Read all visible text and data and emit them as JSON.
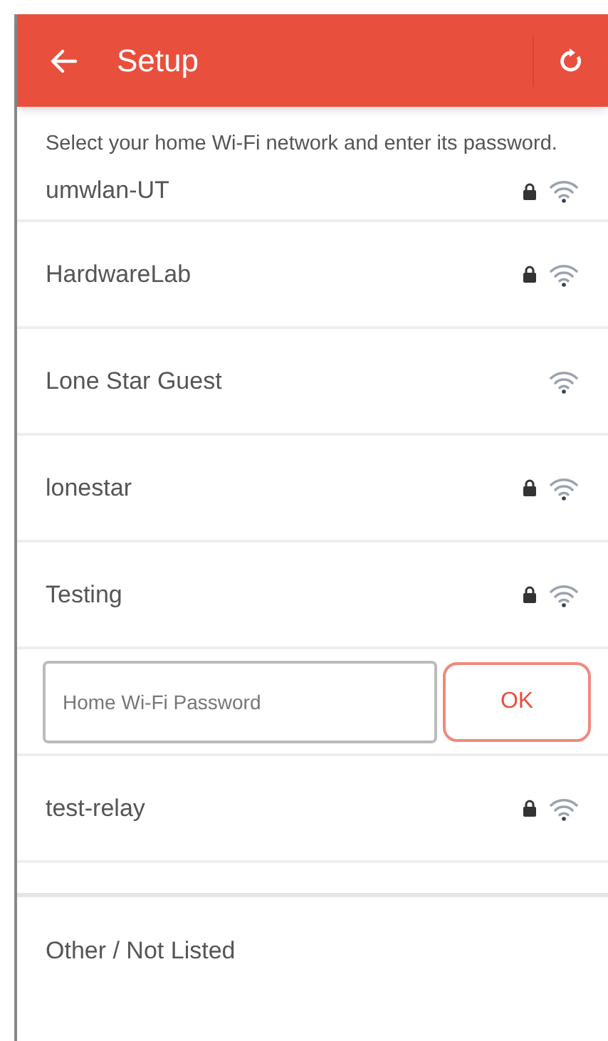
{
  "header": {
    "title": "Setup"
  },
  "instructions": "Select your home Wi-Fi network and enter its password.",
  "networks": [
    {
      "kind": "network",
      "name": "umwlan-UT",
      "locked": true
    },
    {
      "kind": "network",
      "name": "HardwareLab",
      "locked": true
    },
    {
      "kind": "network",
      "name": "Lone Star Guest",
      "locked": false
    },
    {
      "kind": "network",
      "name": "lonestar",
      "locked": true
    },
    {
      "kind": "network",
      "name": "Testing",
      "locked": true
    },
    {
      "kind": "password",
      "placeholder": "Home Wi-Fi Password",
      "button": "OK"
    },
    {
      "kind": "network",
      "name": "test-relay",
      "locked": true
    },
    {
      "kind": "spacer"
    }
  ],
  "other": "Other / Not Listed"
}
